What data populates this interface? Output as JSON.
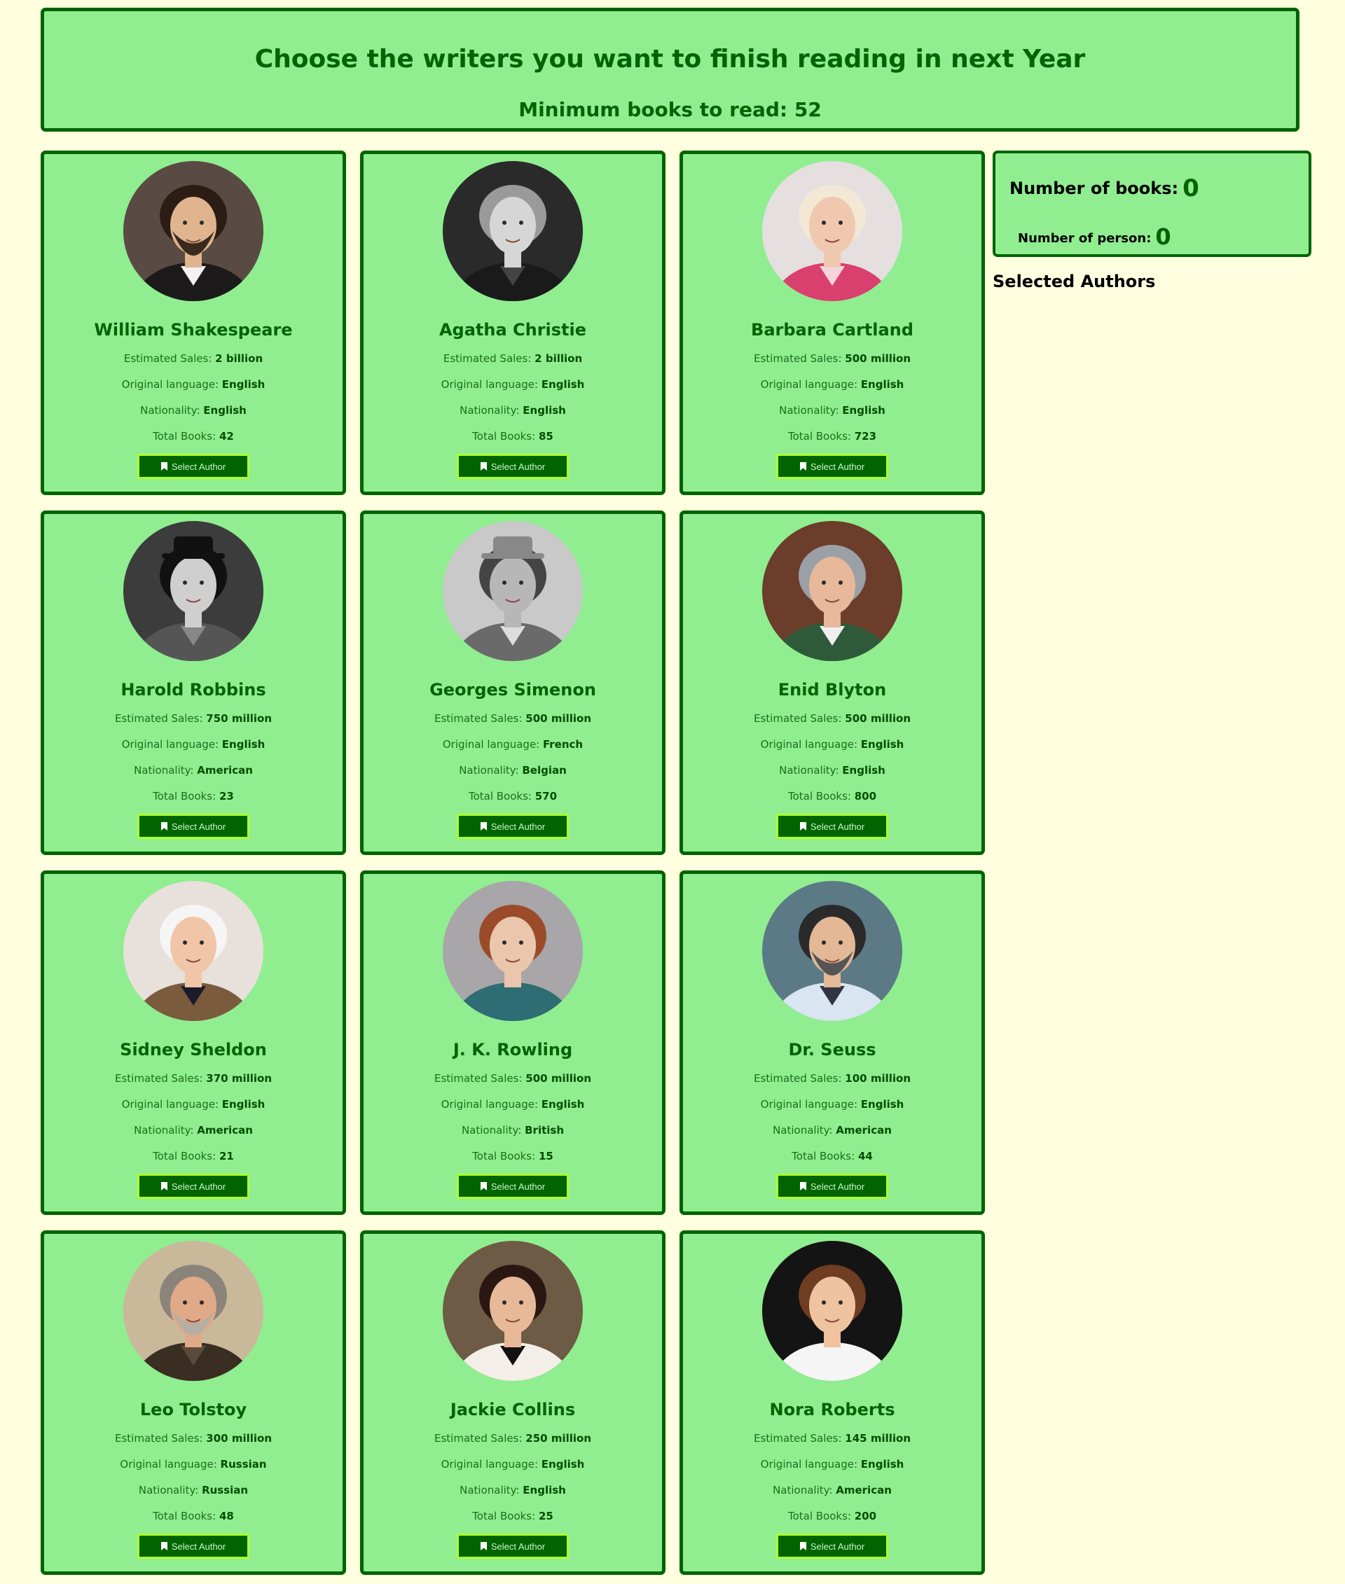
{
  "header": {
    "title": "Choose the writers you want to finish reading in next Year",
    "subtitle": "Minimum books to read: 52"
  },
  "labels": {
    "sales": "Estimated Sales: ",
    "language": "Original language: ",
    "nationality": "Nationality: ",
    "books": "Total Books: ",
    "select_button": "Select Author"
  },
  "summary": {
    "books_label": "Number of books:",
    "books_value": "0",
    "persons_label": "Number of person:",
    "persons_value": "0",
    "selected_title": "Selected Authors"
  },
  "authors": [
    {
      "name": "William Shakespeare",
      "sales": "2 billion",
      "language": "English",
      "nationality": "English",
      "books": "42",
      "portrait": "man-beard"
    },
    {
      "name": "Agatha Christie",
      "sales": "2 billion",
      "language": "English",
      "nationality": "English",
      "books": "85",
      "portrait": "woman-bw"
    },
    {
      "name": "Barbara Cartland",
      "sales": "500 million",
      "language": "English",
      "nationality": "English",
      "books": "723",
      "portrait": "woman-pink"
    },
    {
      "name": "Harold Robbins",
      "sales": "750 million",
      "language": "English",
      "nationality": "American",
      "books": "23",
      "portrait": "man-hat-bw"
    },
    {
      "name": "Georges Simenon",
      "sales": "500 million",
      "language": "French",
      "nationality": "Belgian",
      "books": "570",
      "portrait": "man-pipe-bw"
    },
    {
      "name": "Enid Blyton",
      "sales": "500 million",
      "language": "English",
      "nationality": "English",
      "books": "800",
      "portrait": "woman-library"
    },
    {
      "name": "Sidney Sheldon",
      "sales": "370 million",
      "language": "English",
      "nationality": "American",
      "books": "21",
      "portrait": "man-smile"
    },
    {
      "name": "J. K. Rowling",
      "sales": "500 million",
      "language": "English",
      "nationality": "British",
      "books": "15",
      "portrait": "woman-gray"
    },
    {
      "name": "Dr. Seuss",
      "sales": "100 million",
      "language": "English",
      "nationality": "American",
      "books": "44",
      "portrait": "man-toys"
    },
    {
      "name": "Leo Tolstoy",
      "sales": "300 million",
      "language": "Russian",
      "nationality": "Russian",
      "books": "48",
      "portrait": "man-longbeard"
    },
    {
      "name": "Jackie Collins",
      "sales": "250 million",
      "language": "English",
      "nationality": "English",
      "books": "25",
      "portrait": "woman-book"
    },
    {
      "name": "Nora Roberts",
      "sales": "145 million",
      "language": "English",
      "nationality": "American",
      "books": "200",
      "portrait": "woman-brown"
    }
  ]
}
